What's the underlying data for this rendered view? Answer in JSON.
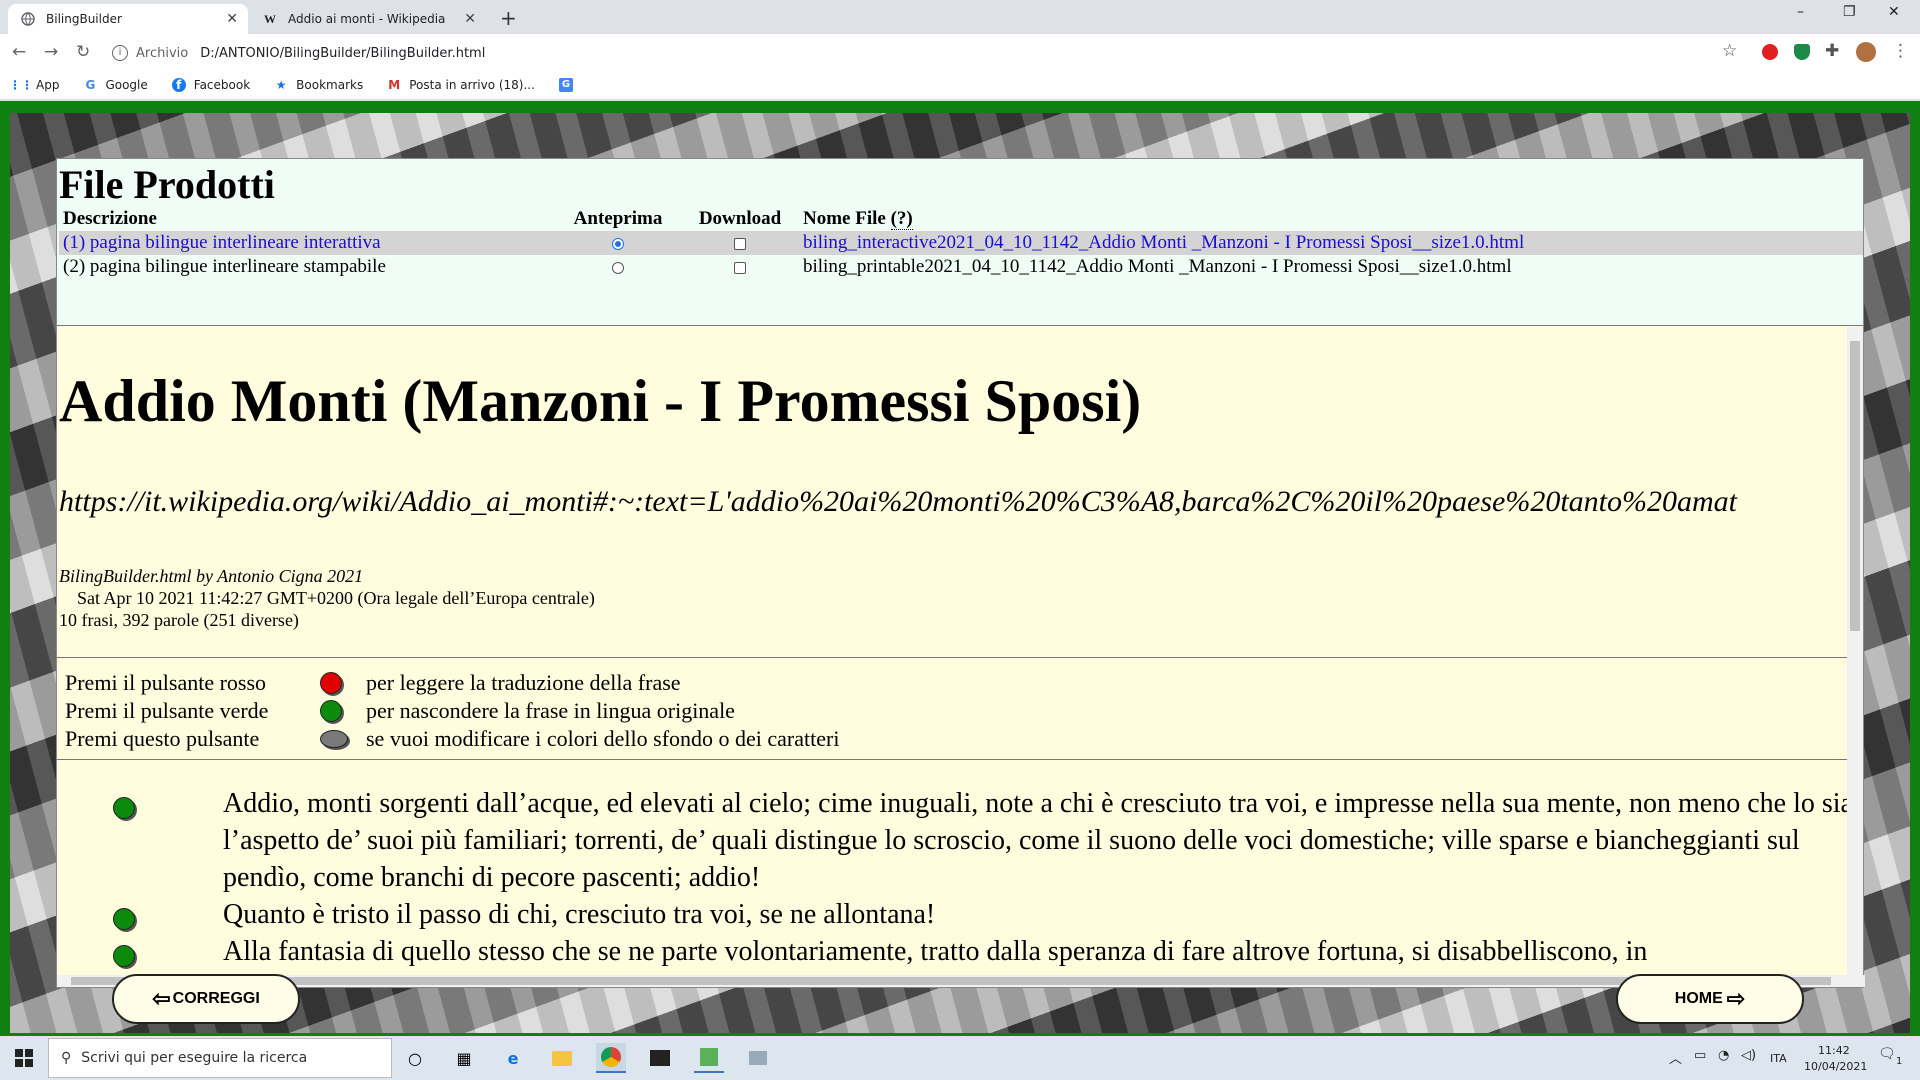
{
  "browser": {
    "tabs": [
      {
        "label": "BilingBuilder",
        "active": true
      },
      {
        "label": "Addio ai monti - Wikipedia",
        "active": false
      }
    ],
    "new_tab": "+",
    "address_chip": "Archivio",
    "address": "D:/ANTONIO/BilingBuilder/BilingBuilder.html",
    "bookmarks": [
      "App",
      "Google",
      "Facebook",
      "Bookmarks",
      "Posta in arrivo (18)..."
    ]
  },
  "files_panel": {
    "title": "File Prodotti",
    "headers": {
      "desc": "Descrizione",
      "preview": "Anteprima",
      "download": "Download",
      "filename": "Nome File",
      "help": "(?)"
    },
    "rows": [
      {
        "desc": "(1) pagina bilingue interlineare interattiva",
        "preview": true,
        "download": false,
        "filename": "biling_interactive2021_04_10_1142_Addio Monti _Manzoni - I Promessi Sposi__size1.0.html"
      },
      {
        "desc": "(2) pagina bilingue interlineare stampabile",
        "preview": false,
        "download": false,
        "filename": "biling_printable2021_04_10_1142_Addio Monti _Manzoni - I Promessi Sposi__size1.0.html"
      }
    ]
  },
  "document": {
    "title": "Addio Monti (Manzoni - I Promessi Sposi)",
    "source_url": "https://it.wikipedia.org/wiki/Addio_ai_monti#:~:text=L'addio%20ai%20monti%20%C3%A8,barca%2C%20il%20paese%20tanto%20amat",
    "credit": "BilingBuilder.html by Antonio Cigna 2021",
    "date": "Sat Apr 10 2021 11:42:27 GMT+0200 (Ora legale dell’Europa centrale)",
    "stats": "10 frasi, 392 parole (251 diverse)",
    "legend": [
      {
        "label": "Premi il pulsante rosso",
        "color": "red",
        "text": "per leggere la traduzione della frase"
      },
      {
        "label": "Premi il pulsante verde",
        "color": "green",
        "text": "per nascondere la frase in lingua originale"
      },
      {
        "label": "Premi questo pulsante",
        "color": "gray",
        "text": "se vuoi modificare i colori dello sfondo o dei caratteri"
      }
    ],
    "sentences": [
      "Addio, monti sorgenti dall’acque, ed elevati al cielo; cime inuguali, note a chi è cresciuto tra voi, e impresse nella sua mente, non meno che lo sia l’aspetto de’ suoi più familiari; torrenti, de’ quali distingue lo scroscio, come il suono delle voci domestiche; ville sparse e biancheggianti sul pendìo, come branchi di pecore pascenti; addio!",
      "Quanto è tristo il passo di chi, cresciuto tra voi, se ne allontana!",
      "Alla fantasia di quello stesso che se ne parte volontariamente, tratto dalla speranza di fare altrove fortuna, si disabbelliscono, in"
    ]
  },
  "buttons": {
    "back": "CORREGGI",
    "home": "HOME"
  },
  "taskbar": {
    "search_placeholder": "Scrivi qui per eseguire la ricerca",
    "lang": "ITA",
    "time": "11:42",
    "date": "10/04/2021",
    "notifications": "1"
  },
  "colors": {
    "page_green": "#108010",
    "panel_bg": "#fffddd",
    "files_bg": "#effdf6",
    "link_blue": "#1a0dd8",
    "selected_row": "#d4d4d4"
  }
}
